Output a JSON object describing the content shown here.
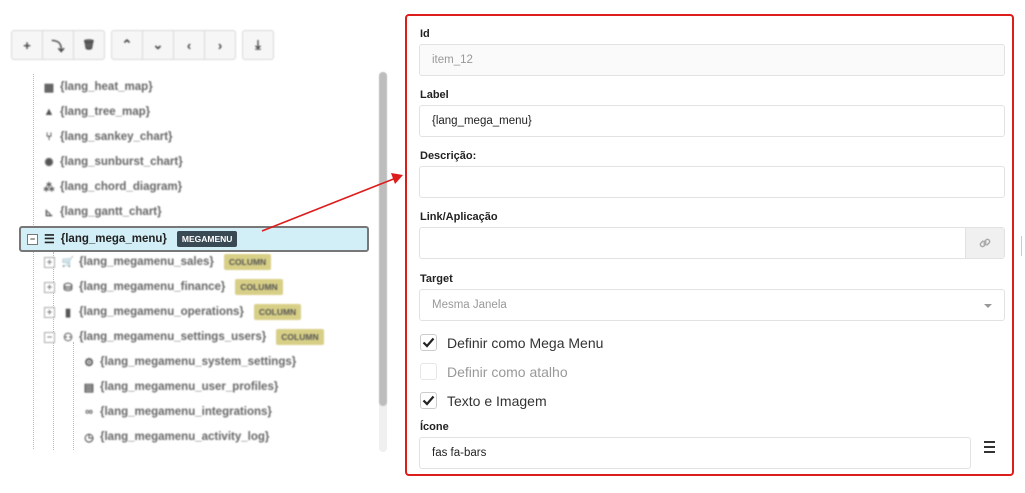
{
  "toolbar": {
    "buttons": [
      {
        "icon": "plus-icon",
        "glyph": "+"
      },
      {
        "icon": "level-down-icon",
        "glyph": "⤵"
      },
      {
        "icon": "trash-icon",
        "glyph": "🗑"
      },
      {
        "icon": "chevron-up-icon",
        "glyph": "⌃"
      },
      {
        "icon": "chevron-down-icon",
        "glyph": "⌄"
      },
      {
        "icon": "chevron-left-icon",
        "glyph": "‹"
      },
      {
        "icon": "chevron-right-icon",
        "glyph": "›"
      },
      {
        "icon": "download-icon",
        "glyph": "⤓"
      }
    ]
  },
  "tree": {
    "items": [
      {
        "label": "{lang_heat_map}",
        "icon": "table-icon",
        "glyph": "▦"
      },
      {
        "label": "{lang_tree_map}",
        "icon": "tree-icon",
        "glyph": "▲"
      },
      {
        "label": "{lang_sankey_chart}",
        "icon": "code-branch-icon",
        "glyph": "⑂"
      },
      {
        "label": "{lang_sunburst_chart}",
        "icon": "sun-icon",
        "glyph": "✺"
      },
      {
        "label": "{lang_chord_diagram}",
        "icon": "project-diagram-icon",
        "glyph": "⁂"
      },
      {
        "label": "{lang_gantt_chart}",
        "icon": "gantt-icon",
        "glyph": "⊾"
      }
    ],
    "selected": {
      "label": "{lang_mega_menu}",
      "badge": "MEGAMENU",
      "icon": "bars-icon",
      "glyph": "☰"
    },
    "children": [
      {
        "label": "{lang_megamenu_sales}",
        "badge": "COLUMN",
        "icon": "cart-icon",
        "glyph": "🛒"
      },
      {
        "label": "{lang_megamenu_finance}",
        "badge": "COLUMN",
        "icon": "hand-holding-usd-icon",
        "glyph": "⛁"
      },
      {
        "label": "{lang_megamenu_operations}",
        "badge": "COLUMN",
        "icon": "clipboard-icon",
        "glyph": "▮"
      },
      {
        "label": "{lang_megamenu_settings_users}",
        "badge": "COLUMN",
        "icon": "users-cog-icon",
        "glyph": "⚇"
      }
    ],
    "grandchildren": [
      {
        "label": "{lang_megamenu_system_settings}",
        "icon": "cog-icon",
        "glyph": "⚙"
      },
      {
        "label": "{lang_megamenu_user_profiles}",
        "icon": "id-card-icon",
        "glyph": "▤"
      },
      {
        "label": "{lang_megamenu_integrations}",
        "icon": "link-icon",
        "glyph": "∞"
      },
      {
        "label": "{lang_megamenu_activity_log}",
        "icon": "clock-icon",
        "glyph": "◷"
      }
    ]
  },
  "form": {
    "id_label": "Id",
    "id_value": "item_12",
    "label_label": "Label",
    "label_value": "{lang_mega_menu}",
    "descricao_label": "Descrição:",
    "descricao_value": "",
    "link_label": "Link/Aplicação",
    "link_value": "",
    "link_icon": "link-icon",
    "target_label": "Target",
    "target_value": "Mesma Janela",
    "checkboxes": [
      {
        "label": "Definir como Mega Menu",
        "checked": true,
        "disabled": false
      },
      {
        "label": "Definir como atalho",
        "checked": false,
        "disabled": true
      },
      {
        "label": "Texto e Imagem",
        "checked": true,
        "disabled": false
      }
    ],
    "icone_label": "Ícone",
    "icone_value": "fas fa-bars",
    "icone_picker_icon": "bars-icon"
  },
  "colors": {
    "highlight_border": "#dd1c1c",
    "selected_row_bg": "#d2eef6",
    "megamenu_badge": "#3a4a55",
    "column_badge": "#d8cf86"
  }
}
